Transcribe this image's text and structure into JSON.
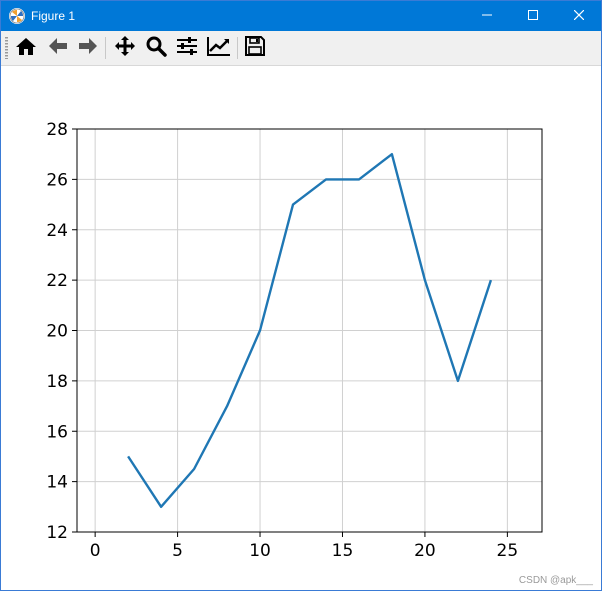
{
  "window": {
    "title": "Figure 1",
    "icon": "matplotlib-icon",
    "controls": [
      "minimize-icon",
      "maximize-icon",
      "close-icon"
    ]
  },
  "toolbar": {
    "buttons": [
      "home-icon",
      "back-arrow-icon",
      "forward-arrow-icon",
      "pan-icon",
      "zoom-icon",
      "subplots-config-icon",
      "edit-axis-icon",
      "save-icon"
    ]
  },
  "watermark": "CSDN @apk___",
  "chart_data": {
    "type": "line",
    "title": "",
    "xlabel": "",
    "ylabel": "",
    "x": [
      2,
      4,
      6,
      8,
      10,
      12,
      14,
      16,
      18,
      20,
      22,
      24
    ],
    "series": [
      {
        "values": [
          15,
          13,
          14.5,
          17,
          20,
          25,
          26,
          26,
          27,
          22,
          18,
          22
        ],
        "color": "#1f77b4"
      }
    ],
    "xlim": [
      -1.1,
      27.1
    ],
    "ylim": [
      12,
      28
    ],
    "xticks": [
      0,
      5,
      10,
      15,
      20,
      25
    ],
    "yticks": [
      12,
      14,
      16,
      18,
      20,
      22,
      24,
      26,
      28
    ],
    "grid": true
  }
}
